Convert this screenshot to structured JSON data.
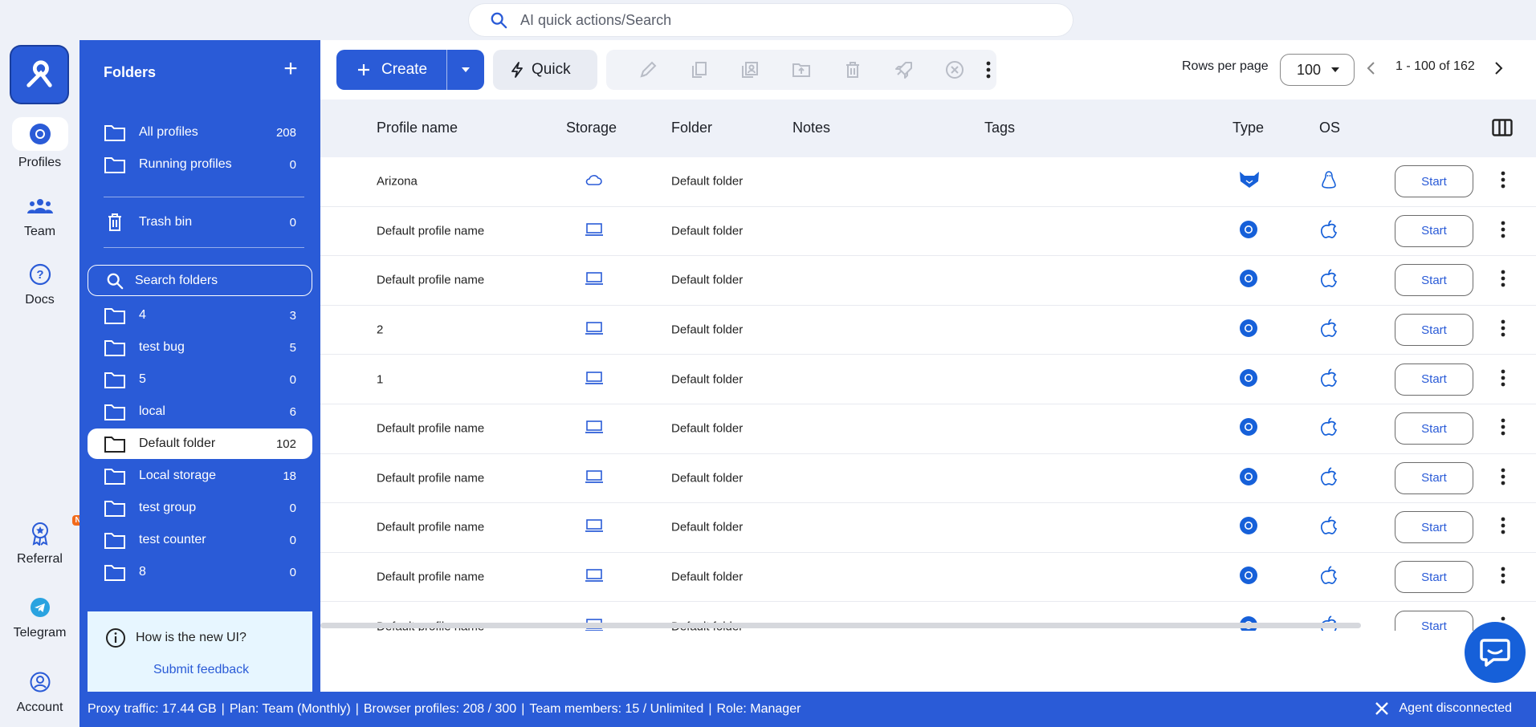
{
  "search": {
    "placeholder": "AI quick actions/Search"
  },
  "nav": {
    "items": [
      {
        "label": "Profiles",
        "icon": "chrome-icon"
      },
      {
        "label": "Team",
        "icon": "team-icon"
      },
      {
        "label": "Docs",
        "icon": "help-icon"
      },
      {
        "label": "Referral",
        "icon": "award-icon",
        "badge": "NEW"
      },
      {
        "label": "Telegram",
        "icon": "telegram-icon"
      },
      {
        "label": "Account",
        "icon": "account-icon"
      }
    ]
  },
  "folders": {
    "title": "Folders",
    "system": [
      {
        "label": "All profiles",
        "count": "208"
      },
      {
        "label": "Running profiles",
        "count": "0"
      },
      {
        "label": "Trash bin",
        "count": "0"
      }
    ],
    "search_placeholder": "Search folders",
    "list": [
      {
        "label": "4",
        "count": "3"
      },
      {
        "label": "test bug",
        "count": "5"
      },
      {
        "label": "5",
        "count": "0"
      },
      {
        "label": "local",
        "count": "6"
      },
      {
        "label": "Default folder",
        "count": "102"
      },
      {
        "label": "Local storage",
        "count": "18"
      },
      {
        "label": "test group",
        "count": "0"
      },
      {
        "label": "test counter",
        "count": "0"
      },
      {
        "label": "8",
        "count": "0"
      }
    ],
    "selected": "Default folder",
    "feedback": {
      "question": "How is the new UI?",
      "link": "Submit feedback"
    }
  },
  "toolbar": {
    "create_label": "Create",
    "quick_label": "Quick",
    "rows_per_page_label": "Rows per page",
    "rows_per_page_value": "100",
    "pagination": "1 - 100 of 162"
  },
  "table": {
    "columns": [
      "Profile name",
      "Storage",
      "Folder",
      "Notes",
      "Tags",
      "Type",
      "OS"
    ],
    "start_label": "Start",
    "rows": [
      {
        "name": "Arizona",
        "storage": "cloud",
        "folder": "Default folder",
        "type": "fox",
        "os": "linux"
      },
      {
        "name": "Default profile name",
        "storage": "local",
        "folder": "Default folder",
        "type": "chromium",
        "os": "apple"
      },
      {
        "name": "Default profile name",
        "storage": "local",
        "folder": "Default folder",
        "type": "chromium",
        "os": "apple"
      },
      {
        "name": "2",
        "storage": "local",
        "folder": "Default folder",
        "type": "chromium",
        "os": "apple"
      },
      {
        "name": "1",
        "storage": "local",
        "folder": "Default folder",
        "type": "chromium",
        "os": "apple"
      },
      {
        "name": "Default profile name",
        "storage": "local",
        "folder": "Default folder",
        "type": "chromium",
        "os": "apple"
      },
      {
        "name": "Default profile name",
        "storage": "local",
        "folder": "Default folder",
        "type": "chromium",
        "os": "apple"
      },
      {
        "name": "Default profile name",
        "storage": "local",
        "folder": "Default folder",
        "type": "chromium",
        "os": "apple"
      },
      {
        "name": "Default profile name",
        "storage": "local",
        "folder": "Default folder",
        "type": "chromium",
        "os": "apple"
      },
      {
        "name": "Default profile name",
        "storage": "local",
        "folder": "Default folder",
        "type": "chromium",
        "os": "apple"
      }
    ]
  },
  "status": {
    "items": [
      "Proxy traffic: 17.44 GB",
      "Plan: Team (Monthly)",
      "Browser profiles: 208 / 300",
      "Team members: 15 / Unlimited",
      "Role: Manager"
    ],
    "agent": "Agent disconnected"
  },
  "colors": {
    "brand": "#2a5bd7",
    "badge": "#f26a1b",
    "feedback_bg": "#e7f6ff"
  }
}
